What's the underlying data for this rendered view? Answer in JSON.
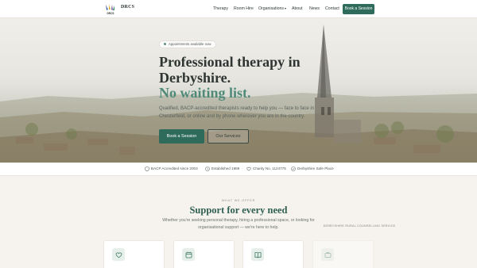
{
  "brand": {
    "name": "DRCS",
    "subtitle": "DERBYSHIRE RURAL COUNSELLING SERVICE",
    "logo_text": "DRCS"
  },
  "nav": {
    "items": [
      {
        "label": "Therapy"
      },
      {
        "label": "Room Hire"
      },
      {
        "label": "Organisations"
      },
      {
        "label": "About"
      },
      {
        "label": "News"
      },
      {
        "label": "Contact"
      }
    ],
    "cta": "Book a Session"
  },
  "hero": {
    "badge": "Appointments available now",
    "title_line1": "Professional therapy in",
    "title_line2": "Derbyshire.",
    "title_accent": "No waiting list.",
    "lead": "Qualified, BACP-accredited therapists ready to help you — face to face in Chesterfield, or online and by phone wherever you are in the country.",
    "primary_button": "Book a Session",
    "secondary_button": "Our Services"
  },
  "trust": [
    {
      "label": "BACP Accredited since 2003",
      "icon": "shield-icon"
    },
    {
      "label": "Established 1989",
      "icon": "clock-icon"
    },
    {
      "label": "Charity No. 1124775",
      "icon": "heart-icon"
    },
    {
      "label": "Derbyshire Safe Place",
      "icon": "check-circle-icon"
    }
  ],
  "services": {
    "eyebrow": "WHAT WE OFFER",
    "title": "Support for every need",
    "subtitle": "Whether you're seeking personal therapy, hiring a professional space, or looking for organisational support — we're here to help.",
    "cards": [
      {
        "icon": "heart-icon"
      },
      {
        "icon": "calendar-icon"
      },
      {
        "icon": "book-icon"
      },
      {
        "icon": "briefcase-icon"
      }
    ]
  },
  "colors": {
    "primary": "#2f6b5b",
    "accent": "#4f8a79",
    "background": "#f6f3ee"
  }
}
